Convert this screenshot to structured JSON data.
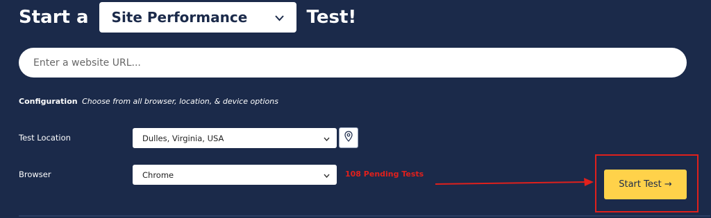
{
  "header": {
    "prefix": "Start a",
    "test_type": "Site Performance",
    "suffix": "Test!"
  },
  "url_input": {
    "value": "",
    "placeholder": "Enter a website URL..."
  },
  "configuration": {
    "title": "Configuration",
    "description": "Choose from all browser, location, & device options"
  },
  "test_location": {
    "label": "Test Location",
    "value": "Dulles, Virginia, USA"
  },
  "browser": {
    "label": "Browser",
    "value": "Chrome"
  },
  "pending": "108 Pending Tests",
  "start_button": "Start Test →",
  "colors": {
    "background": "#1b2a4a",
    "button": "#ffd24a",
    "annotation": "#e0201c"
  },
  "icons": {
    "test_type": "chevron-down-icon",
    "location": "map-pin-icon",
    "annotation": "arrow-right-icon"
  }
}
